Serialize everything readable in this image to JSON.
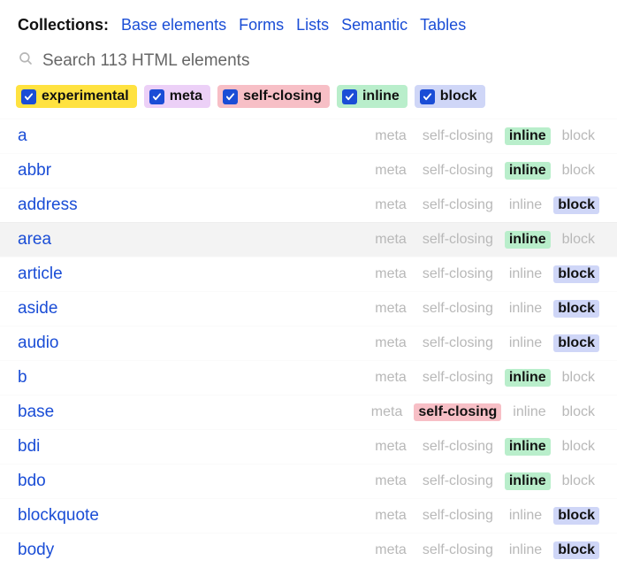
{
  "header": {
    "label": "Collections:",
    "links": [
      "Base elements",
      "Forms",
      "Lists",
      "Semantic",
      "Tables"
    ]
  },
  "search": {
    "placeholder": "Search 113 HTML elements"
  },
  "filters": [
    {
      "id": "experimental",
      "label": "experimental",
      "pill_class": "pill-experimental"
    },
    {
      "id": "meta",
      "label": "meta",
      "pill_class": "pill-meta"
    },
    {
      "id": "selfclosing",
      "label": "self-closing",
      "pill_class": "pill-selfclosing"
    },
    {
      "id": "inline",
      "label": "inline",
      "pill_class": "pill-inline"
    },
    {
      "id": "block",
      "label": "block",
      "pill_class": "pill-block"
    }
  ],
  "tag_labels": [
    "meta",
    "self-closing",
    "inline",
    "block"
  ],
  "elements": [
    {
      "name": "a",
      "active": [
        "inline"
      ],
      "hover": false
    },
    {
      "name": "abbr",
      "active": [
        "inline"
      ],
      "hover": false
    },
    {
      "name": "address",
      "active": [
        "block"
      ],
      "hover": false
    },
    {
      "name": "area",
      "active": [
        "inline"
      ],
      "hover": true
    },
    {
      "name": "article",
      "active": [
        "block"
      ],
      "hover": false
    },
    {
      "name": "aside",
      "active": [
        "block"
      ],
      "hover": false
    },
    {
      "name": "audio",
      "active": [
        "block"
      ],
      "hover": false
    },
    {
      "name": "b",
      "active": [
        "inline"
      ],
      "hover": false
    },
    {
      "name": "base",
      "active": [
        "self-closing"
      ],
      "hover": false
    },
    {
      "name": "bdi",
      "active": [
        "inline"
      ],
      "hover": false
    },
    {
      "name": "bdo",
      "active": [
        "inline"
      ],
      "hover": false
    },
    {
      "name": "blockquote",
      "active": [
        "block"
      ],
      "hover": false
    },
    {
      "name": "body",
      "active": [
        "block"
      ],
      "hover": false
    }
  ]
}
